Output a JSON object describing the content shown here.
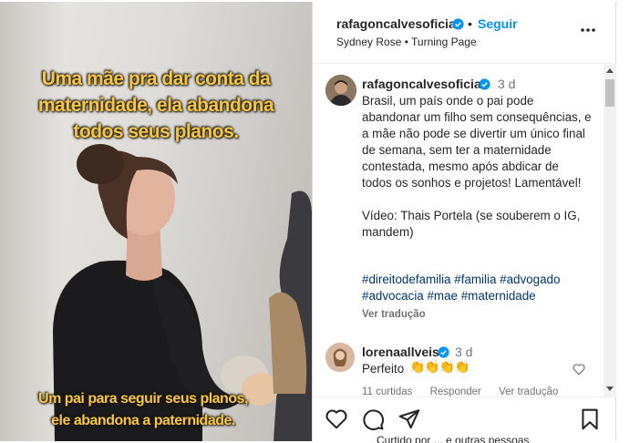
{
  "video": {
    "caption_top_line1": "Uma mãe pra dar conta da",
    "caption_top_line2": "maternidade, ela abandona",
    "caption_top_line3": "todos seus planos.",
    "caption_bottom_line1": "Um pai para seguir seus planos,",
    "caption_bottom_line2": "ele abandona a paternidade."
  },
  "header": {
    "username": "rafagoncalvesoficial",
    "separator": "•",
    "follow_label": "Seguir",
    "audio": "Sydney Rose • Turning Page",
    "more_icon": "more-horizontal-icon"
  },
  "caption": {
    "username": "rafagoncalvesoficial",
    "time": "3 d",
    "text": "Brasil, um país onde o pai pode abandonar um filho sem consequências, e a mãe não pode se divertir um único final de semana, sem ter a maternidade contestada, mesmo após abdicar de todos os sonhos e projetos! Lamentável!\n\nVídeo: Thais Portela (se souberem o IG, mandem)",
    "hashtags": [
      "#direitodefamilia",
      "#familia",
      "#advogado",
      "#advocacia",
      "#mae",
      "#maternidade"
    ],
    "translate_label": "Ver tradução"
  },
  "comments": [
    {
      "username": "lorenaallveis",
      "time": "3 d",
      "text": "Perfeito",
      "emoji": "👏👏👏👏",
      "likes": "11 curtidas",
      "reply_label": "Responder",
      "translate_label": "Ver tradução"
    }
  ],
  "footer": {
    "likes_text": "Curtido por ... e outras pessoas"
  },
  "colors": {
    "accent": "#0095f6",
    "verified": "#0095f6",
    "caption_text": "#f3c64a",
    "hashtag": "#00376b"
  }
}
